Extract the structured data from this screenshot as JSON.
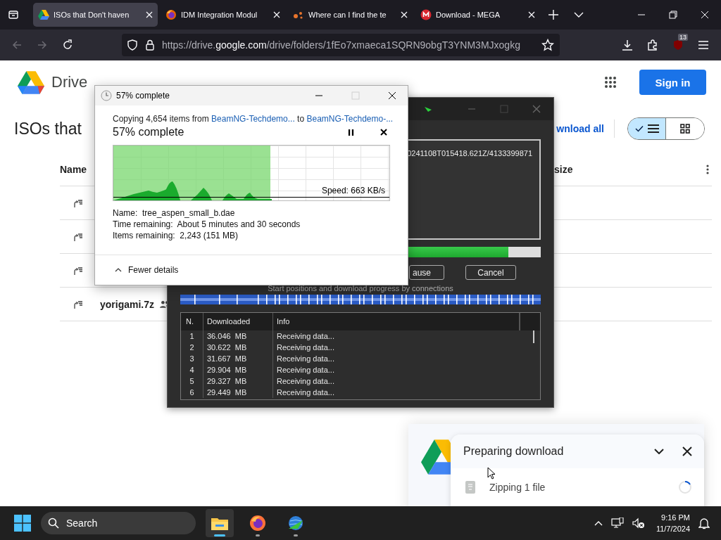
{
  "browser": {
    "tabs": [
      {
        "title": "ISOs that Don't haven",
        "kind": "drive",
        "selected": true
      },
      {
        "title": "IDM Integration Modul",
        "kind": "firefox",
        "selected": false
      },
      {
        "title": "Where can I find the te",
        "kind": "dots",
        "selected": false
      },
      {
        "title": "Download - MEGA",
        "kind": "mega",
        "selected": false
      }
    ],
    "back": {
      "disabled": true
    },
    "forward": {
      "disabled": true
    },
    "url": {
      "scheme": "https://drive.",
      "host": "google.com",
      "path": "/drive/folders/1fEo7xmaeca1SQRN9obgT3YNM3MJxogkg"
    },
    "extension_badge": "13"
  },
  "drive": {
    "brand": "Drive",
    "sign_in": "Sign in",
    "title": "ISOs that",
    "download_all": "wnload all",
    "view": [
      {
        "kind": "list",
        "selected": true
      },
      {
        "kind": "grid",
        "selected": false
      }
    ],
    "columns": [
      "Name",
      "size"
    ],
    "rows": [
      {
        "kind": "shortcut"
      },
      {
        "kind": "shortcut"
      },
      {
        "kind": "shortcut"
      },
      {
        "kind": "shortcut",
        "name": "yorigami.7z",
        "shared": true
      }
    ]
  },
  "copy_dialog": {
    "title": "57% complete",
    "copy_prefix": "Copying 4,654 items from ",
    "source": "BeamNG-Techdemo...",
    "joiner": " to ",
    "destination": "BeamNG-Techdemo-...",
    "heading": "57% complete",
    "maximize_disabled": true,
    "level": 0.57,
    "speed": "Speed: 663 KB/s",
    "details": [
      {
        "label": "Name:",
        "value": "tree_aspen_small_b.dae"
      },
      {
        "label": "Time remaining:",
        "value": "About 5 minutes and 30 seconds"
      },
      {
        "label": "Items remaining:",
        "value": "2,243 (151 MB)"
      }
    ],
    "toggle": "Fewer details"
  },
  "idm": {
    "url_tail": "0241108T015418.621Z/4133399871",
    "level": 0.91,
    "buttons": [
      "ause",
      "Cancel"
    ],
    "connections_label": "Start positions and download progress by connections",
    "columns": [
      "N.",
      "Downloaded",
      "Info"
    ],
    "rows": [
      {
        "n": "1",
        "downloaded": "36.046  MB",
        "info": "Receiving data..."
      },
      {
        "n": "2",
        "downloaded": "30.622  MB",
        "info": "Receiving data..."
      },
      {
        "n": "3",
        "downloaded": "31.667  MB",
        "info": "Receiving data..."
      },
      {
        "n": "4",
        "downloaded": "29.904  MB",
        "info": "Receiving data..."
      },
      {
        "n": "5",
        "downloaded": "29.327  MB",
        "info": "Receiving data..."
      },
      {
        "n": "6",
        "downloaded": "29.449  MB",
        "info": "Receiving data..."
      }
    ]
  },
  "notification": {
    "title": "Preparing download",
    "item": "Zipping 1 file"
  },
  "taskbar": {
    "search": "Search",
    "apps": [
      {
        "kind": "explorer",
        "selected": true
      },
      {
        "kind": "firefox",
        "selected": false
      },
      {
        "kind": "idm",
        "selected": false
      }
    ],
    "time": "9:16 PM",
    "date": "11/7/2024"
  }
}
